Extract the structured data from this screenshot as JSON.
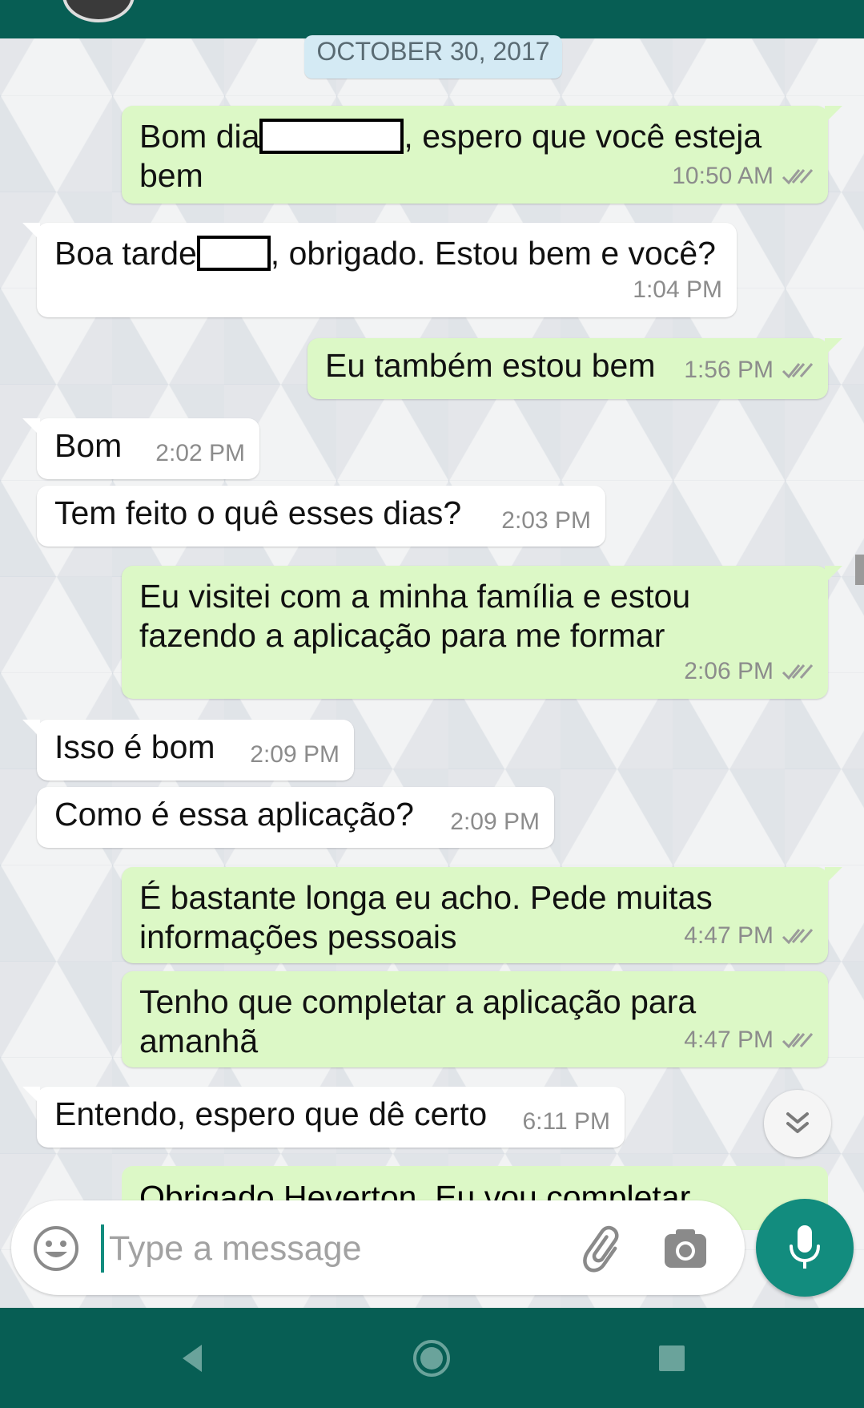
{
  "date_separator": "OCTOBER 30, 2017",
  "messages": [
    {
      "dir": "out",
      "text_before": "Bom dia",
      "text_after": ", espero que você esteja",
      "line2": "bem",
      "time": "10:50 AM"
    },
    {
      "dir": "in",
      "text_before": "Boa tarde",
      "text_after": ", obrigado. Estou bem e você?",
      "time": "1:04 PM"
    },
    {
      "dir": "out",
      "text": "Eu também estou bem",
      "time": "1:56 PM"
    },
    {
      "dir": "in",
      "text": "Bom",
      "time": "2:02 PM"
    },
    {
      "dir": "in",
      "text": "Tem feito o quê esses dias?",
      "time": "2:03 PM"
    },
    {
      "dir": "out",
      "line1": "Eu visitei com a minha família e estou",
      "line2": "fazendo a aplicação para me formar",
      "time": "2:06 PM"
    },
    {
      "dir": "in",
      "text": "Isso é bom",
      "time": "2:09 PM"
    },
    {
      "dir": "in",
      "text": "Como é essa aplicação?",
      "time": "2:09 PM"
    },
    {
      "dir": "out",
      "line1": "É bastante longa eu acho. Pede muitas",
      "line2": "informações pessoais",
      "time": "4:47 PM"
    },
    {
      "dir": "out",
      "line1": "Tenho que completar a aplicação para",
      "line2": "amanhã",
      "time": "4:47 PM"
    },
    {
      "dir": "in",
      "text": "Entendo, espero que dê certo",
      "time": "6:11 PM"
    },
    {
      "dir": "out",
      "text": "Obrigado Heverton. Eu vou completar"
    }
  ],
  "composer": {
    "placeholder": "Type a message"
  },
  "colors": {
    "header": "#075e54",
    "outgoing_bubble": "#dcf8c6",
    "incoming_bubble": "#ffffff",
    "accent": "#128c7e",
    "read_ticks": "#8c8c8c"
  },
  "icons": {
    "emoji": "emoji-icon",
    "attach": "paperclip-icon",
    "camera": "camera-icon",
    "mic": "mic-icon",
    "scroll_down": "double-chevron-down-icon",
    "nav_back": "back-triangle-icon",
    "nav_home": "home-circle-icon",
    "nav_recents": "recents-square-icon"
  }
}
